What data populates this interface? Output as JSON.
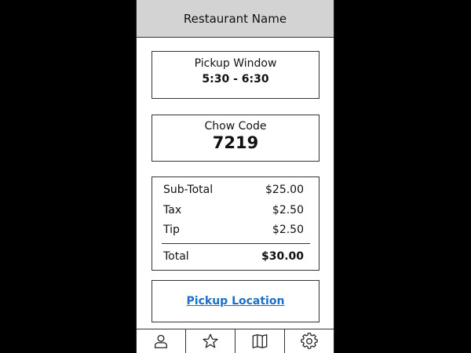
{
  "header": {
    "title": "Restaurant Name"
  },
  "pickup": {
    "label": "Pickup Window",
    "value": "5:30 - 6:30"
  },
  "chow": {
    "label": "Chow Code",
    "value": "7219"
  },
  "totals": {
    "rows": [
      {
        "label": "Sub-Total",
        "amount": "$25.00"
      },
      {
        "label": "Tax",
        "amount": "$2.50"
      },
      {
        "label": "Tip",
        "amount": "$2.50"
      }
    ],
    "total_label": "Total",
    "total_amount": "$30.00"
  },
  "location": {
    "link_label": "Pickup Location",
    "link_color": "#1a6fc8"
  },
  "nav": {
    "icons": [
      "profile-icon",
      "star-icon",
      "map-icon",
      "gear-icon"
    ]
  }
}
